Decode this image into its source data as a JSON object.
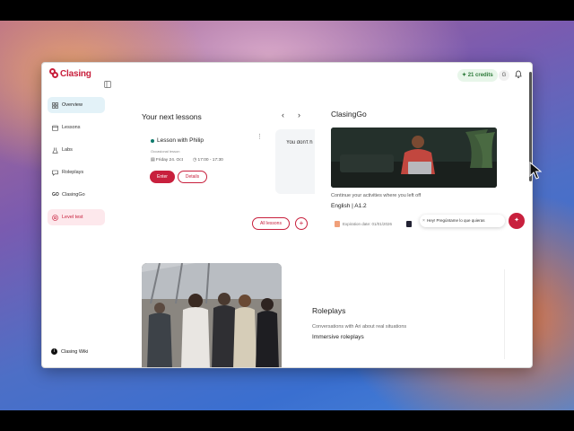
{
  "app": {
    "logo_text": "Clasing",
    "credits": "21 credits",
    "avatar_initial": "G"
  },
  "sidebar": {
    "items": [
      {
        "label": "Overview",
        "icon": "grid-icon",
        "active": true
      },
      {
        "label": "Lessons",
        "icon": "calendar-icon"
      },
      {
        "label": "Labs",
        "icon": "flask-icon"
      },
      {
        "label": "Roleplays",
        "icon": "chat-icon"
      },
      {
        "label": "ClasingGo",
        "icon": "go-icon"
      },
      {
        "label": "Level test",
        "icon": "target-icon",
        "highlight": true
      }
    ],
    "footer_label": "Clasing Wiki"
  },
  "next_lessons": {
    "title": "Your next lessons",
    "card": {
      "name": "Lesson with Philip",
      "type": "Occasional lesson",
      "date": "Friday 24. Oct",
      "time": "17:00 - 17:30",
      "enter_label": "Enter",
      "details_label": "Details"
    },
    "empty_text": "You don't h",
    "all_lessons_label": "All lessons",
    "add_label": "+"
  },
  "clasinggo": {
    "title": "ClasingGo",
    "continue_text": "Continue your activities where you left off",
    "level": "English | A1.2",
    "expiration": "Expiration date: 01/01/2026"
  },
  "chat": {
    "message": "Hey! Pregúntame lo que quieras"
  },
  "roleplays": {
    "title": "Roleplays",
    "subtitle": "Conversations with Ari about real situations",
    "link": "Immersive roleplays"
  },
  "colors": {
    "brand": "#c8203d",
    "credits_bg": "#e8f6ea",
    "active_nav": "#e3f2f8"
  }
}
